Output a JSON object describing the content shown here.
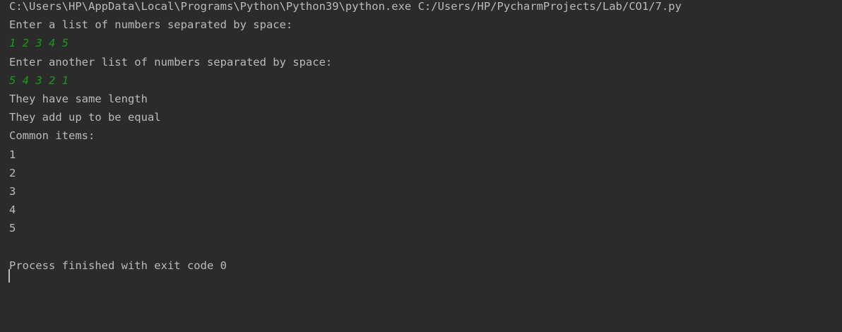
{
  "console": {
    "command_line": "C:\\Users\\HP\\AppData\\Local\\Programs\\Python\\Python39\\python.exe C:/Users/HP/PycharmProjects/Lab/CO1/7.py",
    "prompt_1": "Enter a list of numbers separated by space:",
    "input_1": "1 2 3 4 5",
    "prompt_2": "Enter another list of numbers separated by space:",
    "input_2": "5 4 3 2 1",
    "msg_length": "They have same length",
    "msg_sum": "They add up to be equal",
    "msg_common": "Common items:",
    "items": [
      "1",
      "2",
      "3",
      "4",
      "5"
    ],
    "exit_message": "Process finished with exit code 0"
  },
  "colors": {
    "background": "#2b2b2b",
    "text": "#bbbbbb",
    "input_echo": "#1a9a1a"
  }
}
